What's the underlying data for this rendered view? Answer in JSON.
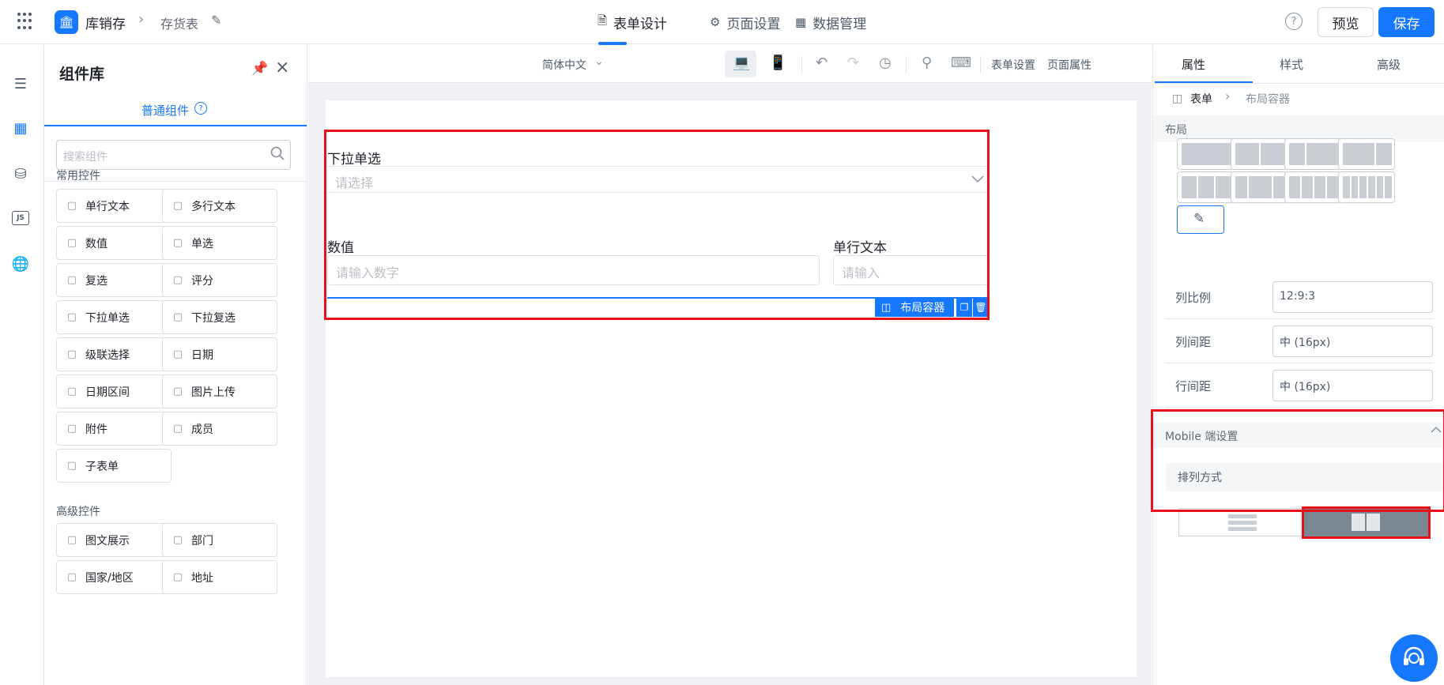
{
  "app": {
    "name": "库销存",
    "page": "存货表"
  },
  "nav": {
    "tabs": [
      {
        "label": "表单设计",
        "icon": "document-icon"
      },
      {
        "label": "页面设置",
        "icon": "gear-icon"
      },
      {
        "label": "数据管理",
        "icon": "grid-icon"
      }
    ]
  },
  "actions": {
    "preview": "预览",
    "save": "保存"
  },
  "library": {
    "title": "组件库",
    "tab": "普通组件",
    "search_placeholder": "搜索组件",
    "common_title": "常用控件",
    "common": [
      {
        "label": "单行文本",
        "icon": "text-input-icon"
      },
      {
        "label": "多行文本",
        "icon": "textarea-icon"
      },
      {
        "label": "数值",
        "icon": "number-icon"
      },
      {
        "label": "单选",
        "icon": "radio-icon"
      },
      {
        "label": "复选",
        "icon": "checkbox-icon"
      },
      {
        "label": "评分",
        "icon": "star-icon"
      },
      {
        "label": "下拉单选",
        "icon": "select-icon"
      },
      {
        "label": "下拉复选",
        "icon": "multiselect-icon"
      },
      {
        "label": "级联选择",
        "icon": "cascade-icon"
      },
      {
        "label": "日期",
        "icon": "calendar-icon"
      },
      {
        "label": "日期区间",
        "icon": "date-range-icon"
      },
      {
        "label": "图片上传",
        "icon": "image-icon"
      },
      {
        "label": "附件",
        "icon": "paperclip-icon"
      },
      {
        "label": "成员",
        "icon": "user-icon"
      },
      {
        "label": "子表单",
        "icon": "subform-icon"
      }
    ],
    "advanced_title": "高级控件",
    "advanced": [
      {
        "label": "图文展示",
        "icon": "richtext-icon"
      },
      {
        "label": "部门",
        "icon": "department-icon"
      },
      {
        "label": "国家/地区",
        "icon": "globe-icon"
      },
      {
        "label": "地址",
        "icon": "location-icon"
      }
    ]
  },
  "toolbar": {
    "language": "简体中文",
    "form_settings": "表单设置",
    "page_props": "页面属性"
  },
  "form": {
    "select_label": "下拉单选",
    "select_placeholder": "请选择",
    "number_label": "数值",
    "number_placeholder": "请输入数字",
    "text_label": "单行文本",
    "text_placeholder": "请输入",
    "container_tag": "布局容器"
  },
  "props": {
    "tabs": [
      "属性",
      "样式",
      "高级"
    ],
    "breadcrumb": [
      "表单",
      "布局容器"
    ],
    "layout_title": "布局",
    "col_ratio_label": "列比例",
    "col_ratio_value": "12:9:3",
    "col_gap_label": "列间距",
    "col_gap_value": "中 (16px)",
    "row_gap_label": "行间距",
    "row_gap_value": "中 (16px)",
    "mobile_title": "Mobile 端设置",
    "arrange_label": "排列方式"
  },
  "colors": {
    "accent": "#1677ff",
    "highlight": "#e8101a"
  }
}
